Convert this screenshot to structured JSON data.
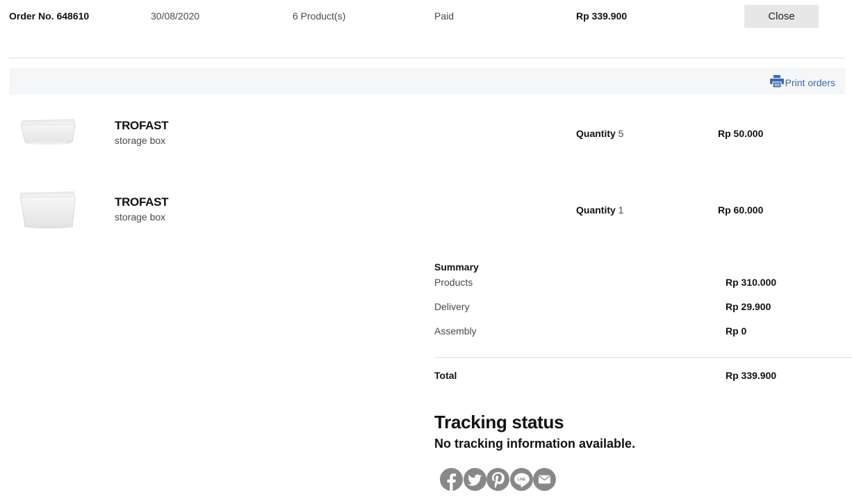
{
  "order": {
    "number": "Order No. 648610",
    "date": "30/08/2020",
    "product_count": "6 Product(s)",
    "status": "Paid",
    "total": "Rp 339.900",
    "close_label": "Close"
  },
  "print": {
    "label": "Print orders",
    "icon": "printer-icon"
  },
  "products": [
    {
      "name": "TROFAST",
      "description": "storage box",
      "quantity_label": "Quantity",
      "quantity": "5",
      "price": "Rp 50.000",
      "image": "storage-box-shallow"
    },
    {
      "name": "TROFAST",
      "description": "storage box",
      "quantity_label": "Quantity",
      "quantity": "1",
      "price": "Rp 60.000",
      "image": "storage-box-deep"
    }
  ],
  "summary": {
    "title": "Summary",
    "rows": [
      {
        "label": "Products",
        "value": "Rp 310.000"
      },
      {
        "label": "Delivery",
        "value": "Rp 29.900"
      },
      {
        "label": "Assembly",
        "value": "Rp 0"
      }
    ],
    "total_label": "Total",
    "total_value": "Rp 339.900"
  },
  "tracking": {
    "title": "Tracking status",
    "message": "No tracking information available."
  },
  "share_icons": [
    "facebook-icon",
    "twitter-icon",
    "pinterest-icon",
    "line-icon",
    "email-icon"
  ],
  "colors": {
    "link": "#3b6ab1",
    "share_icon_bg": "#888888",
    "close_button_bg": "#e7e7e7",
    "print_bar_bg": "#f5f6f8"
  }
}
